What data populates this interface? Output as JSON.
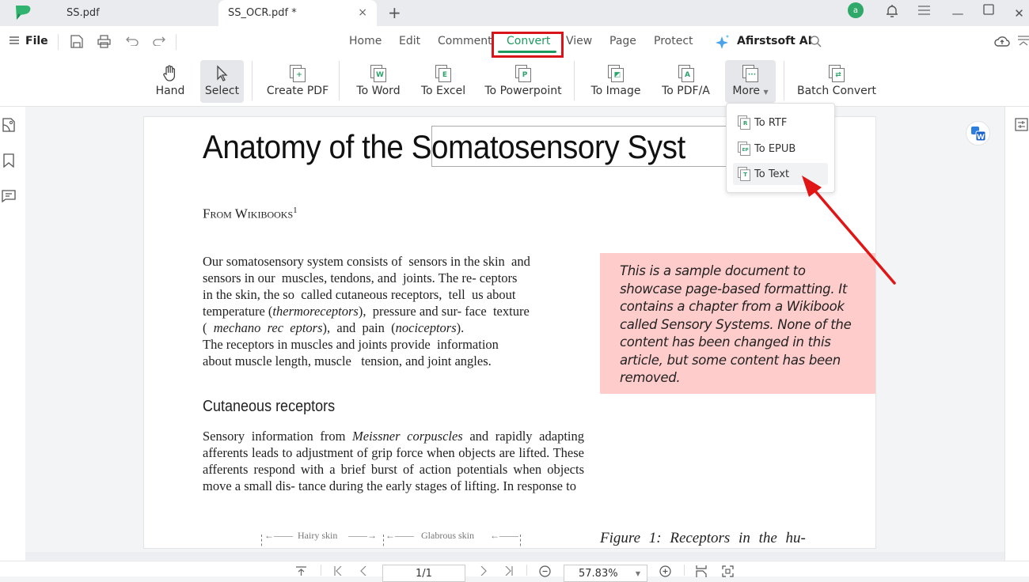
{
  "titlebar": {
    "tabs": [
      {
        "label": "SS.pdf",
        "active": false
      },
      {
        "label": "SS_OCR.pdf *",
        "active": true
      }
    ],
    "close_tab_icon": "×",
    "new_tab_icon": "+",
    "avatar_initial": "a",
    "window_controls": {
      "minimize": "—",
      "maximize": "☐",
      "close": "✕"
    }
  },
  "menubar": {
    "file_label": "File",
    "nav": [
      "Home",
      "Edit",
      "Comment",
      "Convert",
      "View",
      "Page",
      "Protect"
    ],
    "active_nav": "Convert",
    "ai_label": "Afirstsoft AI"
  },
  "ribbon": {
    "buttons": [
      {
        "label": "Hand",
        "icon": "hand-icon"
      },
      {
        "label": "Select",
        "icon": "cursor-icon",
        "selected": true
      },
      {
        "label": "Create PDF",
        "icon": "create-pdf-icon",
        "glyph": "+"
      },
      {
        "label": "To Word",
        "icon": "word-icon",
        "glyph": "W"
      },
      {
        "label": "To Excel",
        "icon": "excel-icon",
        "glyph": "E"
      },
      {
        "label": "To Powerpoint",
        "icon": "powerpoint-icon",
        "glyph": "P"
      },
      {
        "label": "To Image",
        "icon": "image-icon",
        "glyph": "◩"
      },
      {
        "label": "To PDF/A",
        "icon": "pdfa-icon",
        "glyph": "A"
      },
      {
        "label": "More",
        "icon": "more-icon",
        "glyph": "···"
      },
      {
        "label": "Batch Convert",
        "icon": "batch-convert-icon",
        "glyph": "⇄"
      }
    ]
  },
  "more_menu": {
    "items": [
      {
        "label": "To RTF",
        "glyph": "R"
      },
      {
        "label": "To EPUB",
        "glyph": "EP"
      },
      {
        "label": "To Text",
        "glyph": "T"
      }
    ],
    "highlighted": "To Text"
  },
  "document": {
    "title": "Anatomy of the Somatosensory Syst",
    "from": "From Wikibooks",
    "from_sup": "1",
    "para1": [
      "Our somatosensory system consists of  sensors in the skin  and",
      "sensors in our  muscles, tendons, and  joints. The re- ceptors",
      "in the skin, the so  called cutaneous receptors,  tell  us about",
      "temperature (<i>thermoreceptors</i>),  pressure and sur- face  texture",
      "(  <i>mechano  rec  eptors</i>),  and  pain  (<i>nociceptors</i>).",
      "The receptors in muscles and joints provide  information",
      "about muscle length, muscle   tension, and joint angles."
    ],
    "heading": "Cutaneous receptors",
    "para2": "Sensory information from <i>Meissner corpuscles</i> and rapidly adapting afferents leads to adjustment of grip force when objects are lifted. These afferents respond with a brief burst of action potentials when objects move a small dis- tance during the early stages of lifting. In response to",
    "note": "This is a sample document to showcase page-based formatting. It contains a chapter from a Wikibook called Sensory Systems. None of the content has been changed in this article, but some content has been removed.",
    "figure_caption": "Figure 1:   Receptors in the hu-",
    "figure_labels": [
      "Hairy skin",
      "Glabrous skin"
    ],
    "note_bg": "#ffcccc"
  },
  "bottombar": {
    "page": "1/1",
    "zoom": "57.83%"
  },
  "colors": {
    "accent": "#1f9a5f",
    "highlight_box": "#d9141b",
    "arrow": "#e01515"
  }
}
